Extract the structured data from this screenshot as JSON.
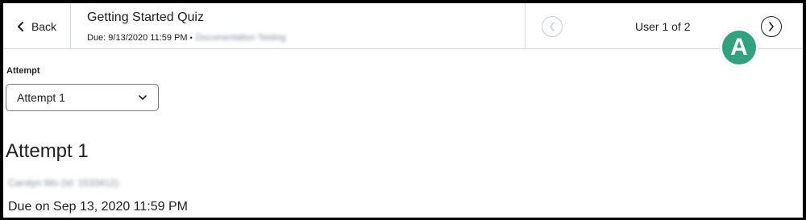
{
  "header": {
    "back_label": "Back",
    "quiz_title": "Getting Started Quiz",
    "due_text": "Due: 9/13/2020 11:59 PM",
    "due_separator": "•",
    "org_unit": "Documentation Testing",
    "user_position": "User 1 of 2"
  },
  "callout": {
    "label": "A",
    "color": "#2ea37e"
  },
  "attempt": {
    "label": "Attempt",
    "selected": "Attempt 1",
    "heading": "Attempt 1",
    "user_name": "Carolyn Wo (Id: 1533412)",
    "due_on": "Due on Sep 13, 2020 11:59 PM"
  },
  "icons": {
    "back": "chevron-left-icon",
    "prev": "chevron-left-circle-icon",
    "next": "chevron-right-circle-icon",
    "dropdown": "chevron-down-icon"
  }
}
